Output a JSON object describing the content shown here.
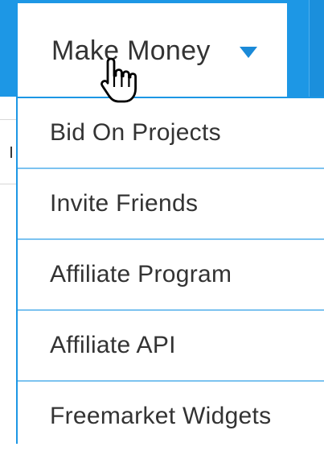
{
  "navbar": {
    "menu_label": "Make Money",
    "menu_caret_icon": "caret-down-icon",
    "cursor_icon": "hand-pointer-icon"
  },
  "dropdown": {
    "items": [
      {
        "label": "Bid On Projects"
      },
      {
        "label": "Invite Friends"
      },
      {
        "label": "Affiliate Program"
      },
      {
        "label": "Affiliate API"
      },
      {
        "label": "Freemarket Widgets"
      }
    ]
  },
  "colors": {
    "nav_blue": "#1d97e5",
    "divider_blue": "#7cc3f0",
    "text": "#333333"
  }
}
